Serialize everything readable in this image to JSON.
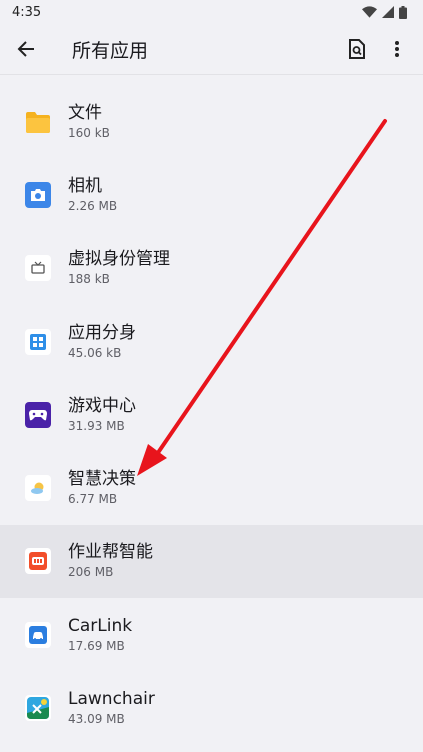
{
  "status": {
    "time": "4:35"
  },
  "header": {
    "title": "所有应用"
  },
  "apps": [
    {
      "name": "文件",
      "size": "160 kB",
      "icon": "folder-icon"
    },
    {
      "name": "相机",
      "size": "2.26 MB",
      "icon": "camera-icon"
    },
    {
      "name": "虚拟身份管理",
      "size": "188 kB",
      "icon": "tv-icon"
    },
    {
      "name": "应用分身",
      "size": "45.06 kB",
      "icon": "app-grid-icon"
    },
    {
      "name": "游戏中心",
      "size": "31.93 MB",
      "icon": "gamepad-icon"
    },
    {
      "name": "智慧决策",
      "size": "6.77 MB",
      "icon": "weather-icon"
    },
    {
      "name": "作业帮智能",
      "size": "206 MB",
      "icon": "zuoyebang-icon"
    },
    {
      "name": "CarLink",
      "size": "17.69 MB",
      "icon": "car-icon"
    },
    {
      "name": "Lawnchair",
      "size": "43.09 MB",
      "icon": "lawnchair-icon"
    }
  ],
  "colors": {
    "arrow": "#e8141c",
    "highlight": "#e4e4e9"
  }
}
